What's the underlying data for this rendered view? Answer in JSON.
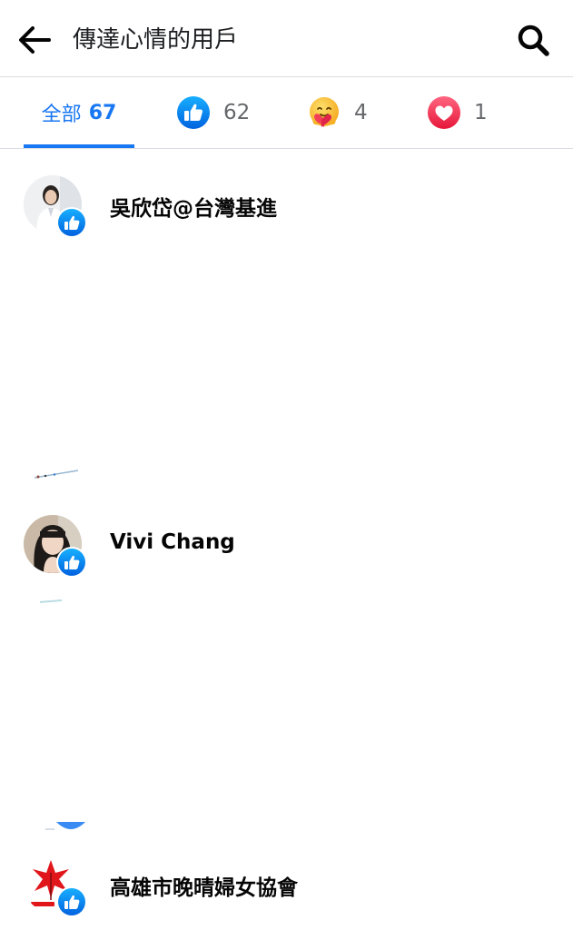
{
  "header": {
    "title": "傳達心情的用戶",
    "back_icon": "arrow-left-icon",
    "search_icon": "search-icon"
  },
  "tabs": [
    {
      "label": "全部",
      "count": "67",
      "selected": true
    },
    {
      "reaction": "like-icon",
      "count": "62"
    },
    {
      "reaction": "care-icon",
      "count": "4"
    },
    {
      "reaction": "love-icon",
      "count": "1"
    }
  ],
  "users": [
    {
      "name": "吳欣岱@台灣基進",
      "reaction": "like-icon"
    },
    {
      "name": "Vivi Chang",
      "reaction": "like-icon"
    },
    {
      "name": "高雄市晚晴婦女協會",
      "reaction": "like-icon"
    }
  ],
  "colors": {
    "accent": "#1877f2",
    "text_primary": "#050505",
    "text_secondary": "#65676b",
    "divider": "#dadde1",
    "love": "#f33e58",
    "care": "#f7b125"
  }
}
